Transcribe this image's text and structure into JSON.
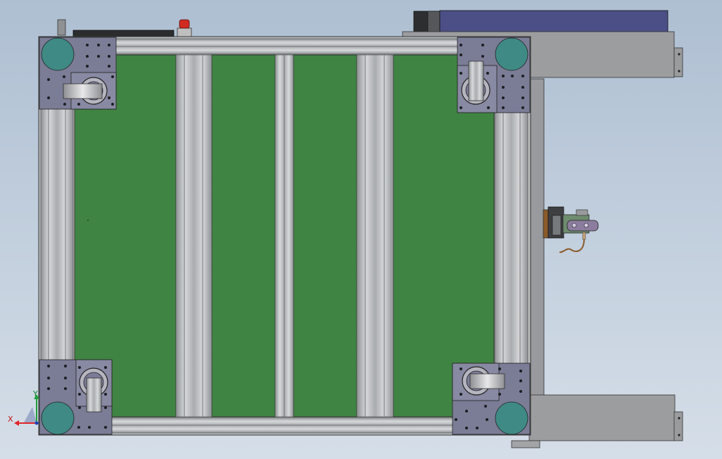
{
  "viewport": {
    "background_top": "#aebfd2",
    "background_bottom": "#d5dee8"
  },
  "colors": {
    "panel_green": "#408443",
    "frame_aluminum": "#b9bcbe",
    "frame_shadow": "#7d8184",
    "plate_purple": "#7b7c96",
    "foot_teal": "#3f8a84",
    "caster_gray": "#a9a9ab",
    "motor_blue": "#4b4f86",
    "beam_gray": "#9c9d9f",
    "indicator_red": "#d02a22",
    "cable_brown": "#8a5a2b",
    "axis_x": "#e0262a",
    "axis_y": "#22a03b",
    "axis_z": "#2040c0"
  },
  "triad": {
    "x_label": "X",
    "y_label": "Y"
  }
}
